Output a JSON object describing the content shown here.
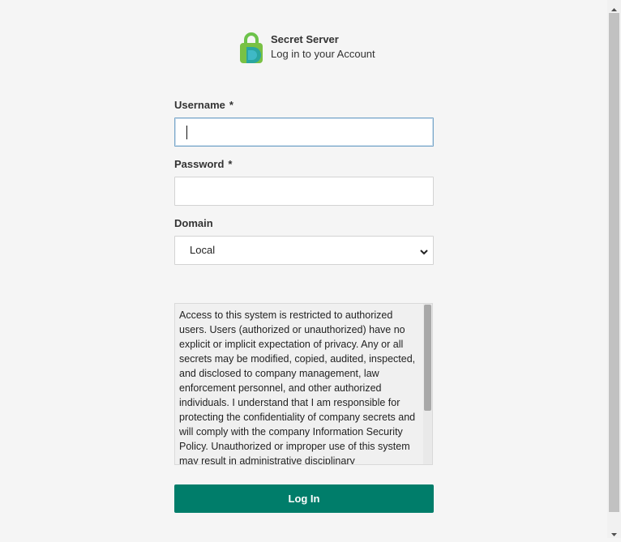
{
  "header": {
    "app_title": "Secret Server",
    "subtitle": "Log in to your Account"
  },
  "form": {
    "username": {
      "label": "Username",
      "required_mark": "*",
      "value": ""
    },
    "password": {
      "label": "Password",
      "required_mark": "*",
      "value": ""
    },
    "domain": {
      "label": "Domain",
      "selected": "Local"
    }
  },
  "banner": {
    "text": "Access to this system is restricted to authorized users. Users (authorized or unauthorized) have no explicit or implicit expectation of privacy. Any or all secrets may be modified, copied, audited, inspected, and disclosed to company management, law enforcement personnel, and other authorized individuals. I understand that I am responsible for protecting the confidentiality of company secrets and will comply with the company Information Security Policy. Unauthorized or improper use of this system may result in administrative disciplinary"
  },
  "login_button": {
    "label": "Log In"
  },
  "colors": {
    "accent": "#007d6a",
    "logo_green": "#5cb85c",
    "logo_teal": "#2bb3a3"
  },
  "icons": [
    "lock-logo-icon",
    "chevron-down-icon"
  ]
}
